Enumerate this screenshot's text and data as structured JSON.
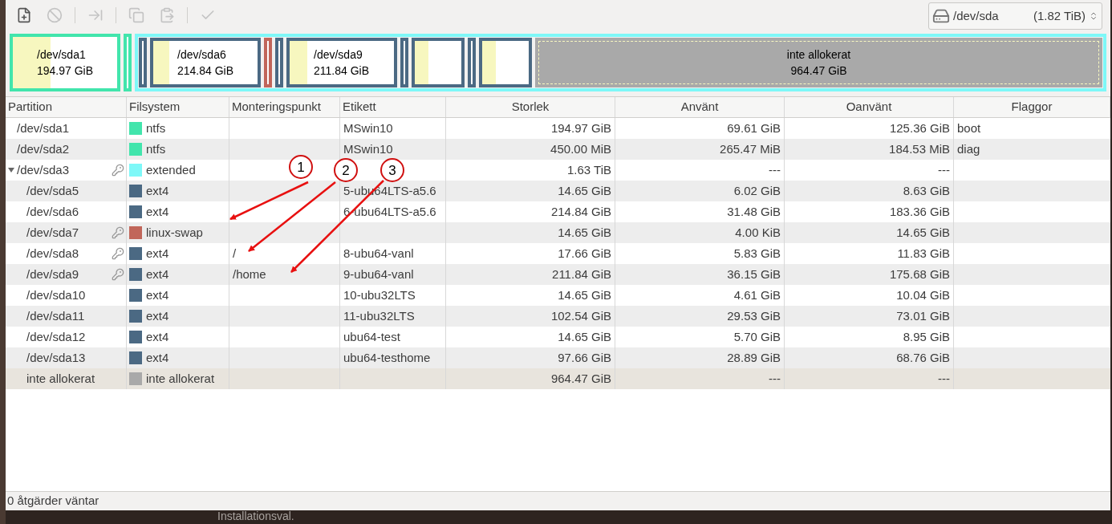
{
  "toolbar": [
    {
      "kind": "new",
      "disabled": false
    },
    {
      "kind": "delete",
      "disabled": true
    },
    {
      "kind": "resize",
      "disabled": true
    },
    {
      "kind": "copy",
      "disabled": true
    },
    {
      "kind": "paste",
      "disabled": true
    },
    {
      "kind": "apply",
      "disabled": true
    }
  ],
  "device": {
    "name": "/dev/sda",
    "size": "(1.82 TiB)"
  },
  "disk_map": [
    {
      "kind": "partition",
      "color": "#42e5ac",
      "label": "/dev/sda1",
      "size": "194.97 GiB",
      "level": 0.36
    },
    {
      "kind": "sliver",
      "color": "#42e5ac"
    },
    {
      "kind": "extended",
      "color": "#7ef8f8",
      "children": [
        {
          "kind": "sliver",
          "color": "#4b6983"
        },
        {
          "kind": "partition",
          "color": "#4b6983",
          "label": "/dev/sda6",
          "size": "214.84 GiB",
          "level": 0.15
        },
        {
          "kind": "sliver",
          "color": "#c1665a"
        },
        {
          "kind": "sliver",
          "color": "#4b6983"
        },
        {
          "kind": "partition",
          "color": "#4b6983",
          "label": "/dev/sda9",
          "size": "211.84 GiB",
          "level": 0.17
        },
        {
          "kind": "sliver",
          "color": "#4b6983"
        },
        {
          "kind": "box",
          "color": "#4b6983",
          "level": 0.29
        },
        {
          "kind": "sliver",
          "color": "#4b6983"
        },
        {
          "kind": "box",
          "color": "#4b6983",
          "level": 0.3
        },
        {
          "kind": "unallocated",
          "color": "#a9a9a9",
          "label": "inte allokerat",
          "size": "964.47 GiB"
        }
      ]
    }
  ],
  "table": {
    "columns": [
      "Partition",
      "Filsystem",
      "Monteringspunkt",
      "Etikett",
      "Storlek",
      "Använt",
      "Oanvänt",
      "Flaggor"
    ],
    "rows": [
      {
        "kind": "partition",
        "partition": "/dev/sda1",
        "locked": false,
        "fs": "ntfs",
        "color": "#42e5ac",
        "label": "MSwin10",
        "size": "194.97 GiB",
        "used": "69.61 GiB",
        "unused": "125.36 GiB",
        "flags": "boot"
      },
      {
        "kind": "partition",
        "partition": "/dev/sda2",
        "locked": false,
        "fs": "ntfs",
        "color": "#42e5ac",
        "label": "MSwin10",
        "size": "450.00 MiB",
        "used": "265.47 MiB",
        "unused": "184.53 MiB",
        "flags": "diag"
      },
      {
        "kind": "partition",
        "partition": "/dev/sda3",
        "locked": true,
        "expanded": true,
        "fs": "extended",
        "color": "#7ef8f8",
        "size": "1.63 TiB",
        "used": "---",
        "unused": "---",
        "children": [
          {
            "kind": "partition",
            "partition": "/dev/sda5",
            "locked": false,
            "fs": "ext4",
            "color": "#4b6983",
            "label": "5-ubu64LTS-a5.6",
            "size": "14.65 GiB",
            "used": "6.02 GiB",
            "unused": "8.63 GiB"
          },
          {
            "kind": "partition",
            "partition": "/dev/sda6",
            "locked": false,
            "fs": "ext4",
            "color": "#4b6983",
            "label": "6-ubu64LTS-a5.6",
            "size": "214.84 GiB",
            "used": "31.48 GiB",
            "unused": "183.36 GiB"
          },
          {
            "kind": "partition",
            "partition": "/dev/sda7",
            "locked": true,
            "fs": "linux-swap",
            "color": "#c1665a",
            "size": "14.65 GiB",
            "used": "4.00 KiB",
            "unused": "14.65 GiB"
          },
          {
            "kind": "partition",
            "partition": "/dev/sda8",
            "locked": true,
            "fs": "ext4",
            "color": "#4b6983",
            "mount": "/",
            "label": "8-ubu64-vanl",
            "size": "17.66 GiB",
            "used": "5.83 GiB",
            "unused": "11.83 GiB"
          },
          {
            "kind": "partition",
            "partition": "/dev/sda9",
            "locked": true,
            "fs": "ext4",
            "color": "#4b6983",
            "mount": "/home",
            "label": "9-ubu64-vanl",
            "size": "211.84 GiB",
            "used": "36.15 GiB",
            "unused": "175.68 GiB"
          },
          {
            "kind": "partition",
            "partition": "/dev/sda10",
            "locked": false,
            "fs": "ext4",
            "color": "#4b6983",
            "label": "10-ubu32LTS",
            "size": "14.65 GiB",
            "used": "4.61 GiB",
            "unused": "10.04 GiB"
          },
          {
            "kind": "partition",
            "partition": "/dev/sda11",
            "locked": false,
            "fs": "ext4",
            "color": "#4b6983",
            "label": "11-ubu32LTS",
            "size": "102.54 GiB",
            "used": "29.53 GiB",
            "unused": "73.01 GiB"
          },
          {
            "kind": "partition",
            "partition": "/dev/sda12",
            "locked": false,
            "fs": "ext4",
            "color": "#4b6983",
            "label": "ubu64-test",
            "size": "14.65 GiB",
            "used": "5.70 GiB",
            "unused": "8.95 GiB"
          },
          {
            "kind": "partition",
            "partition": "/dev/sda13",
            "locked": false,
            "fs": "ext4",
            "color": "#4b6983",
            "label": "ubu64-testhome",
            "size": "97.66 GiB",
            "used": "28.89 GiB",
            "unused": "68.76 GiB"
          },
          {
            "kind": "unallocated",
            "partition": "inte allokerat",
            "locked": false,
            "fs": "inte allokerat",
            "color": "#a9a9a9",
            "size": "964.47 GiB",
            "used": "---",
            "unused": "---"
          }
        ]
      }
    ]
  },
  "annotations": [
    {
      "label": "1"
    },
    {
      "label": "2"
    },
    {
      "label": "3"
    }
  ],
  "status_bar": "0 åtgärder väntar",
  "background_text": "Installationsval."
}
